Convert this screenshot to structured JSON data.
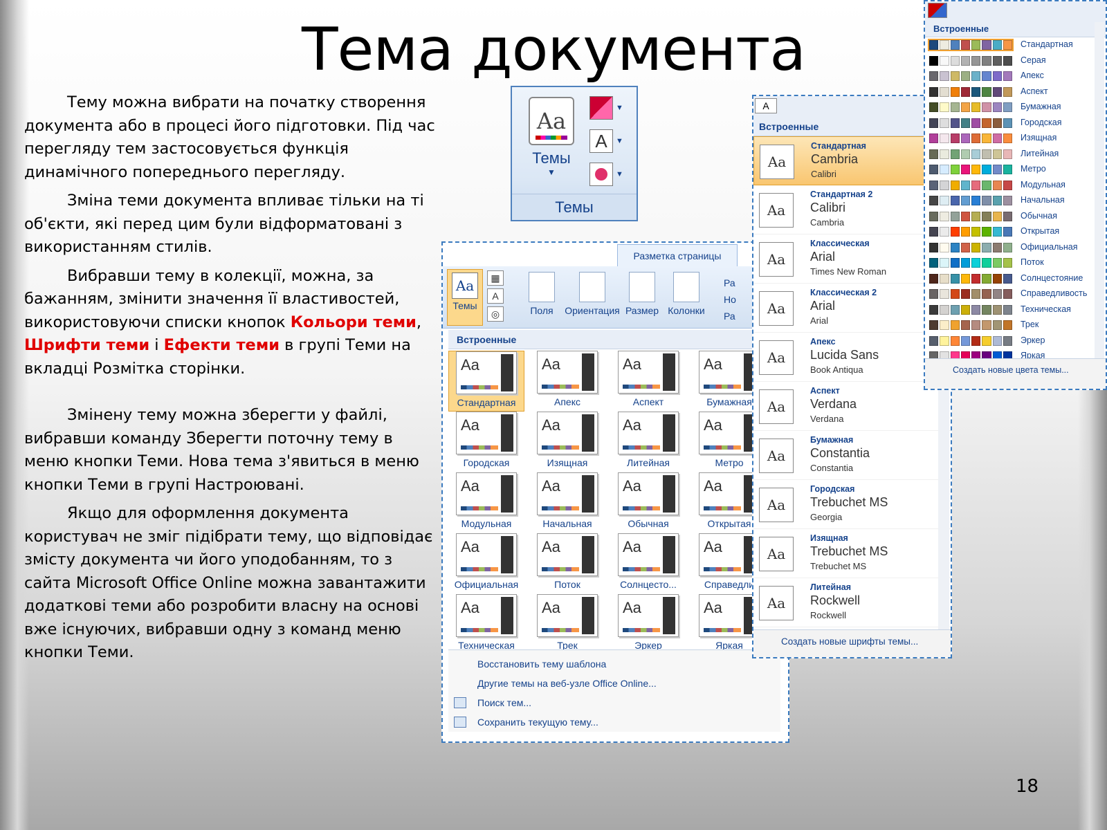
{
  "slide": {
    "title": "Тема документа",
    "page_number": "18",
    "p1": "Тему можна вибрати на початку створення документа або в процесі його підготовки. Під час перегляду тем застосовується функція динамічного попереднього перегляду.",
    "p2": "Зміна теми документа впливає тільки на ті об'єкти, які перед цим були відформатовані з використанням стилів.",
    "p3_a": "Вибравши тему в колекції, можна, за бажанням, змінити значення її властивостей, використовуючи списки кнопок ",
    "p3_red1": "Кольори теми",
    "p3_b": ", ",
    "p3_red2": "Шрифти теми",
    "p3_c": " і ",
    "p3_red3": "Ефекти теми",
    "p3_d": "  в групі Теми на вкладці Розмітка сторінки.",
    "p4": "Змінену тему можна зберегти у файлі, вибравши команду Зберегти поточну тему в меню кнопки Теми. Нова тема з'явиться в меню кнопки Теми в групі Настроювані.",
    "p5": "Якщо для оформлення документа користувач не зміг підібрати тему, що відповідає змісту документа чи його уподобанням, то з сайта Microsoft Office Online можна завантажити додаткові теми або розробити власну на основі вже існуючих, вибравши одну з команд меню кнопки Теми."
  },
  "ribbon_group": {
    "button_label": "Темы",
    "group_label": "Темы"
  },
  "gallery": {
    "tab": "Разметка страницы",
    "themes_btn": "Темы",
    "tools": [
      "Поля",
      "Ориентация",
      "Размер",
      "Колонки"
    ],
    "cut_labels": [
      "Ра",
      "Но",
      "Ра"
    ],
    "header": "Встроенные",
    "themes": [
      "Стандартная",
      "Апекс",
      "Аспект",
      "Бумажная",
      "Городская",
      "Изящная",
      "Литейная",
      "Метро",
      "Модульная",
      "Начальная",
      "Обычная",
      "Открытая",
      "Официальная",
      "Поток",
      "Солнцесто...",
      "Справедли",
      "Техническая",
      "Трек",
      "Эркер",
      "Яркая"
    ],
    "menu": [
      "Восстановить тему шаблона",
      "Другие темы на веб-узле Office Online...",
      "Поиск тем...",
      "Сохранить текущую тему..."
    ]
  },
  "fonts": {
    "btn": "A",
    "header": "Встроенные",
    "items": [
      {
        "name": "Стандартная",
        "heading": "Cambria",
        "body": "Calibri"
      },
      {
        "name": "Стандартная 2",
        "heading": "Calibri",
        "body": "Cambria"
      },
      {
        "name": "Классическая",
        "heading": "Arial",
        "body": "Times New Roman"
      },
      {
        "name": "Классическая 2",
        "heading": "Arial",
        "body": "Arial"
      },
      {
        "name": "Апекс",
        "heading": "Lucida Sans",
        "body": "Book Antiqua"
      },
      {
        "name": "Аспект",
        "heading": "Verdana",
        "body": "Verdana"
      },
      {
        "name": "Бумажная",
        "heading": "Constantia",
        "body": "Constantia"
      },
      {
        "name": "Городская",
        "heading": "Trebuchet MS",
        "body": "Georgia"
      },
      {
        "name": "Изящная",
        "heading": "Trebuchet MS",
        "body": "Trebuchet MS"
      },
      {
        "name": "Литейная",
        "heading": "Rockwell",
        "body": "Rockwell"
      }
    ],
    "footer": "Создать новые шрифты темы..."
  },
  "colors": {
    "header": "Встроенные",
    "items": [
      {
        "name": "Стандартная",
        "sw": [
          "#1f497d",
          "#eeece1",
          "#4f81bd",
          "#c0504d",
          "#9bbb59",
          "#8064a2",
          "#4bacc6",
          "#f79646"
        ]
      },
      {
        "name": "Серая",
        "sw": [
          "#000000",
          "#f8f8f8",
          "#dddddd",
          "#b2b2b2",
          "#969696",
          "#808080",
          "#5f5f5f",
          "#4d4d4d"
        ]
      },
      {
        "name": "Апекс",
        "sw": [
          "#69676d",
          "#c9c2d1",
          "#ceb966",
          "#9cb084",
          "#6bb1c9",
          "#6585cf",
          "#7e6bc9",
          "#a379bb"
        ]
      },
      {
        "name": "Аспект",
        "sw": [
          "#323232",
          "#e3ded1",
          "#f07f09",
          "#9f2936",
          "#1b587c",
          "#4e8542",
          "#604878",
          "#c19859"
        ]
      },
      {
        "name": "Бумажная",
        "sw": [
          "#444d26",
          "#fefac9",
          "#a5b592",
          "#f3a447",
          "#e7bc29",
          "#d092a7",
          "#9c85c0",
          "#809ec2"
        ]
      },
      {
        "name": "Городская",
        "sw": [
          "#424456",
          "#dedede",
          "#53548a",
          "#438086",
          "#a04da3",
          "#c4652d",
          "#8b5d3d",
          "#5c92b5"
        ]
      },
      {
        "name": "Изящная",
        "sw": [
          "#b13f9a",
          "#f4e7ed",
          "#b83d68",
          "#ac66bb",
          "#de6c36",
          "#f9b639",
          "#cf6da4",
          "#fa8d3d"
        ]
      },
      {
        "name": "Литейная",
        "sw": [
          "#676a55",
          "#eaebde",
          "#72a376",
          "#b0ccb0",
          "#a8cdd7",
          "#c0beaf",
          "#cec597",
          "#e8b7b7"
        ]
      },
      {
        "name": "Метро",
        "sw": [
          "#4e5b6f",
          "#d6ecff",
          "#7fd13b",
          "#ea157a",
          "#feb80a",
          "#00addc",
          "#738ac8",
          "#1ab39f"
        ]
      },
      {
        "name": "Модульная",
        "sw": [
          "#5a6378",
          "#d4d4d6",
          "#f0ad00",
          "#60b5cc",
          "#e66c7d",
          "#6bb76d",
          "#e88651",
          "#c64847"
        ]
      },
      {
        "name": "Начальная",
        "sw": [
          "#464646",
          "#deedf3",
          "#4a66ac",
          "#629dd1",
          "#297fd5",
          "#7f8fa9",
          "#5aa2ae",
          "#9d90a0"
        ]
      },
      {
        "name": "Обычная",
        "sw": [
          "#686b5d",
          "#eeece1",
          "#93a299",
          "#cf543f",
          "#b5ae53",
          "#848058",
          "#e8b54d",
          "#786c71"
        ]
      },
      {
        "name": "Открытая",
        "sw": [
          "#454551",
          "#ebebeb",
          "#ff3e00",
          "#ff9d00",
          "#c4c000",
          "#5db300",
          "#36b9d2",
          "#4a78b6"
        ]
      },
      {
        "name": "Официальная",
        "sw": [
          "#333333",
          "#fffbef",
          "#2d83c3",
          "#d16349",
          "#ccb400",
          "#8cadae",
          "#8c7b70",
          "#8fb08c"
        ]
      },
      {
        "name": "Поток",
        "sw": [
          "#04617b",
          "#dbf5f9",
          "#0f6fc6",
          "#009dd9",
          "#0bd0d9",
          "#10cf9b",
          "#7cca62",
          "#a5c249"
        ]
      },
      {
        "name": "Солнцестояние",
        "sw": [
          "#4f271c",
          "#e7dec9",
          "#3891a7",
          "#feb80a",
          "#c32d2e",
          "#84aa33",
          "#964305",
          "#475a8d"
        ]
      },
      {
        "name": "Справедливость",
        "sw": [
          "#696464",
          "#e9e5dc",
          "#d34817",
          "#9b2d1f",
          "#a28e6a",
          "#956251",
          "#918485",
          "#855d5d"
        ]
      },
      {
        "name": "Техническая",
        "sw": [
          "#3b3b3b",
          "#d4d2d0",
          "#6ea0b0",
          "#ccaf0a",
          "#8d89a4",
          "#748560",
          "#9e9273",
          "#7e848d"
        ]
      },
      {
        "name": "Трек",
        "sw": [
          "#4e3b30",
          "#fbeec9",
          "#f0a22e",
          "#a5644e",
          "#b58b80",
          "#c3986d",
          "#a19574",
          "#c17529"
        ]
      },
      {
        "name": "Эркер",
        "sw": [
          "#575f6d",
          "#fff39d",
          "#fe8637",
          "#7598d9",
          "#b32c16",
          "#f5cd2d",
          "#aebad5",
          "#777c84"
        ]
      },
      {
        "name": "Яркая",
        "sw": [
          "#666666",
          "#e2e2e2",
          "#ff388c",
          "#e40059",
          "#9c007f",
          "#68007f",
          "#005bd3",
          "#00349e"
        ]
      }
    ],
    "footer": "Создать новые цвета темы..."
  }
}
